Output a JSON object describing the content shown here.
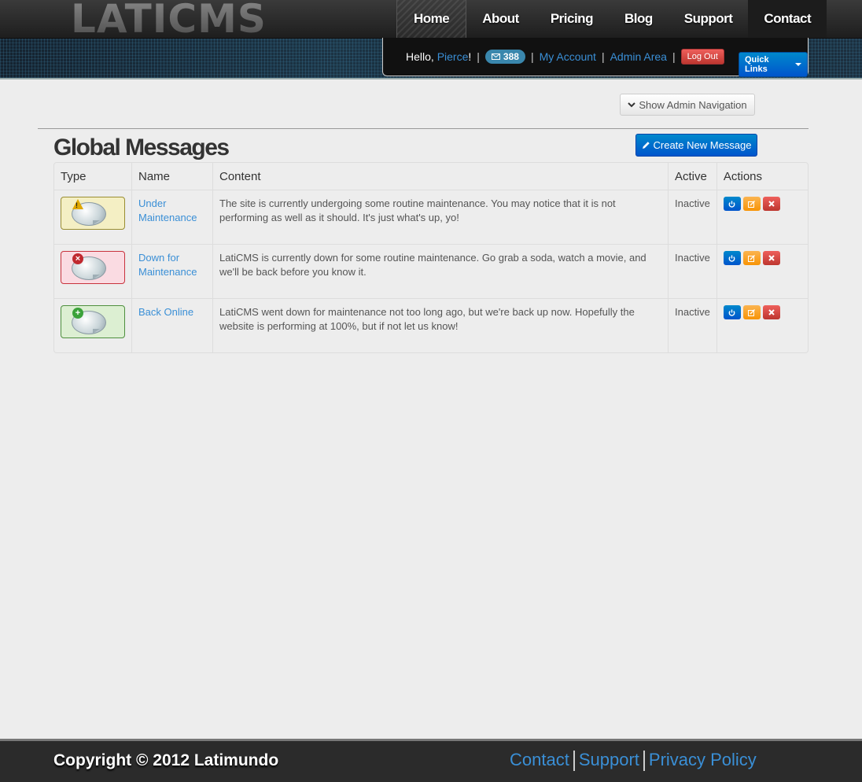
{
  "brand": {
    "logo_text": "LATICMS"
  },
  "nav": {
    "items": [
      "Home",
      "About",
      "Pricing",
      "Blog",
      "Support",
      "Contact"
    ]
  },
  "userbar": {
    "hello_prefix": "Hello, ",
    "username": "Pierce",
    "hello_suffix": "!",
    "messages_count": "388",
    "my_account": "My Account",
    "admin_area": "Admin Area",
    "logout": "Log Out",
    "quick_links": "Quick Links"
  },
  "admin_nav_toggle": "Show Admin Navigation",
  "page": {
    "title": "Global Messages",
    "create_button": "Create New Message"
  },
  "table": {
    "headers": [
      "Type",
      "Name",
      "Content",
      "Active",
      "Actions"
    ],
    "rows": [
      {
        "type": "warning",
        "name": "Under Maintenance",
        "content": "The site is currently undergoing some routine maintenance. You may notice that it is not performing as well as it should. It's just what's up, yo!",
        "active": "Inactive"
      },
      {
        "type": "error",
        "name": "Down for Maintenance",
        "content": "LatiCMS is currently down for some routine maintenance. Go grab a soda, watch a movie, and we'll be back before you know it.",
        "active": "Inactive"
      },
      {
        "type": "success",
        "name": "Back Online",
        "content": "LatiCMS went down for maintenance not too long ago, but we're back up now. Hopefully the website is performing at 100%, but if not let us know!",
        "active": "Inactive"
      }
    ]
  },
  "footer": {
    "copyright": "Copyright © 2012 Latimundo",
    "links": [
      "Contact",
      "Support",
      "Privacy Policy"
    ]
  },
  "icons": {
    "message_badge": "envelope-icon",
    "admin_nav": "chevron-down-icon",
    "create": "pencil-icon",
    "row_actions": [
      "power-icon",
      "edit-icon",
      "close-icon"
    ]
  },
  "colors": {
    "accent": "#0066cc",
    "link": "#3a8fd6",
    "danger": "#bd362f",
    "warning": "#f89406"
  }
}
